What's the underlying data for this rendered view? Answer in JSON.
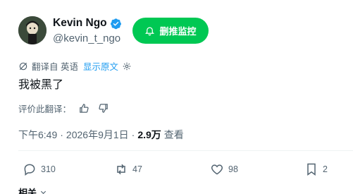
{
  "user": {
    "name": "Kevin Ngo",
    "handle": "@kevin_t_ngo"
  },
  "subscribe_button": {
    "label": "删推监控"
  },
  "translation": {
    "label": "翻译自 英语",
    "show_original": "显示原文"
  },
  "tweet": {
    "text": "我被黑了"
  },
  "rate_translation": {
    "label": "评价此翻译："
  },
  "meta": {
    "time": "下午6:49",
    "sep1": "·",
    "date": "2026年9月1日",
    "sep2": "·",
    "views_count": "2.9万",
    "views_label": "查看"
  },
  "actions": {
    "replies": "310",
    "retweets": "47",
    "likes": "98",
    "bookmarks": "2"
  },
  "related": {
    "label": "相关"
  },
  "colors": {
    "accent": "#1d9bf0",
    "subscribe_green": "#00c853",
    "muted_text": "#536471"
  },
  "icons": [
    "verified-badge-icon",
    "bell-icon",
    "translate-icon",
    "settings-icon",
    "thumbs-up-icon",
    "thumbs-down-icon",
    "reply-icon",
    "retweet-icon",
    "like-icon",
    "bookmark-icon",
    "chevron-down-icon"
  ]
}
